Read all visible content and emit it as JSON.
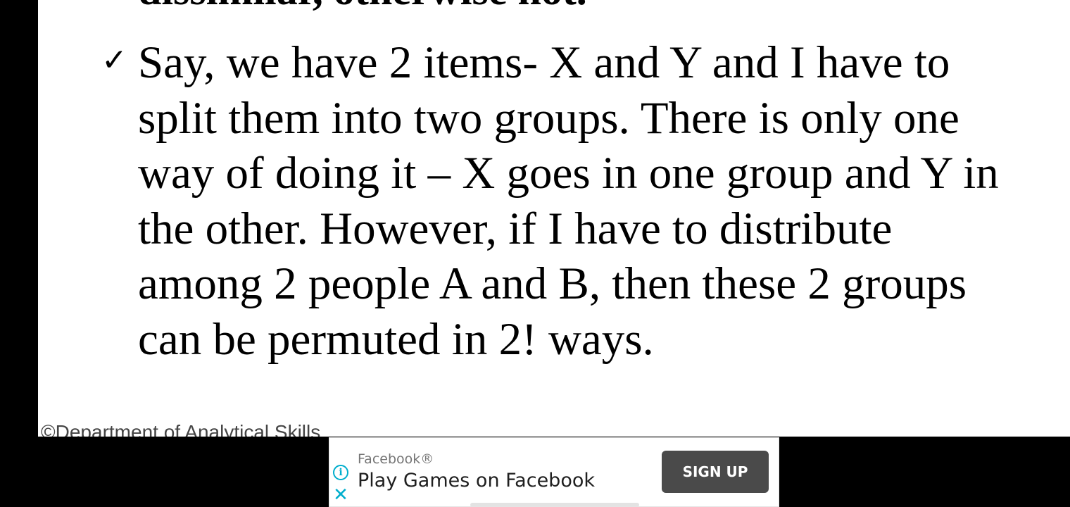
{
  "slide": {
    "heading_fragment": "dissimilar, otherwise not.",
    "bullet_lines": [
      "Say, we have 2 items- X and Y and I have to",
      "split them into two groups. There is only one",
      "way of doing it – X goes in one group and Y in",
      "the other. However, if I have to distribute",
      "among 2 people A and B, then these 2 groups",
      "can be permuted in 2! ways."
    ],
    "bullet_icon": "check-mark-icon",
    "footer": "©Department of Analytical Skills"
  },
  "ad": {
    "advertiser": "Facebook®",
    "headline": "Play Games on Facebook",
    "cta_label": "SIGN UP",
    "info_icon": "info-icon",
    "close_icon": "close-icon",
    "accent_color": "#00aecd",
    "cta_color": "#4a4a4a"
  }
}
